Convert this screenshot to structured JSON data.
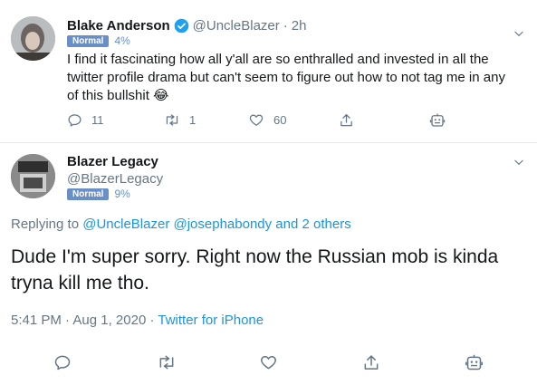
{
  "tweet1": {
    "name": "Blake Anderson",
    "handle": "@UncleBlazer",
    "sep": "·",
    "time": "2h",
    "badge": "Normal",
    "badge_pct": "4%",
    "text": "I find it fascinating how all y'all are so enthralled and invested in all the twitter profile drama but can't seem to figure out how to not tag me in any of this bullshit 😂",
    "reply_count": "11",
    "retweet_count": "1",
    "like_count": "60"
  },
  "tweet2": {
    "name": "Blazer Legacy",
    "handle": "@BlazerLegacy",
    "badge": "Normal",
    "badge_pct": "9%",
    "replying_prefix": "Replying to",
    "reply_to_1": "@UncleBlazer",
    "reply_to_2": "@josephabondy",
    "reply_and_others": "and 2 others",
    "text": "Dude I'm super sorry. Right now the Russian mob is kinda tryna kill me tho.",
    "meta_time": "5:41 PM",
    "meta_sep1": "·",
    "meta_date": "Aug 1, 2020",
    "meta_sep2": "·",
    "meta_source": "Twitter for iPhone"
  },
  "colors": {
    "verified": "#1da1f2",
    "link": "#1b95e0",
    "badge": "#6a8fc6",
    "muted": "#657786"
  }
}
